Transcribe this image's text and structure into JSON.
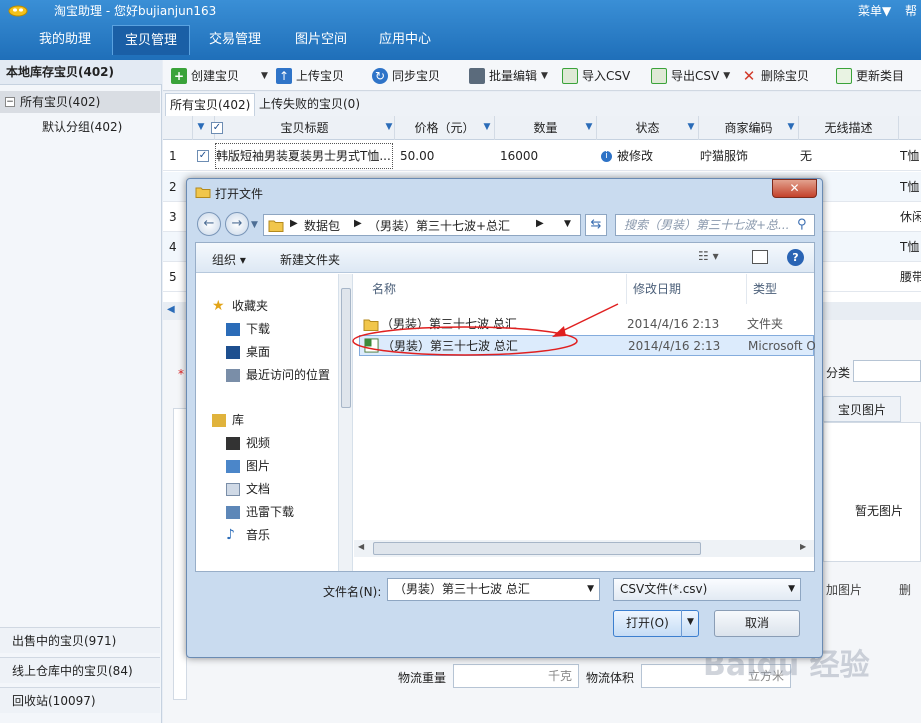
{
  "app": {
    "title": "淘宝助理 - 您好bujianjun163",
    "menu_label": "菜单▼",
    "help_label": "帮"
  },
  "nav": {
    "tabs": [
      "我的助理",
      "宝贝管理",
      "交易管理",
      "图片空间",
      "应用中心"
    ],
    "active_index": 1
  },
  "sidebar": {
    "title": "本地库存宝贝(402)",
    "tree": {
      "toggle": "−",
      "root": "所有宝贝(402)",
      "child": "默认分组(402)"
    },
    "bottom": [
      "出售中的宝贝(971)",
      "线上仓库中的宝贝(84)",
      "回收站(10097)"
    ]
  },
  "toolbar": {
    "items": [
      {
        "label": "创建宝贝",
        "icon": "plus-icon",
        "color": "#3aa33a"
      },
      {
        "label": "上传宝贝",
        "icon": "upload-icon",
        "color": "#2f74c8"
      },
      {
        "label": "同步宝贝",
        "icon": "sync-icon",
        "color": "#2f74c8"
      },
      {
        "label": "批量编辑",
        "icon": "batch-edit-icon",
        "color": "#555555"
      },
      {
        "label": "导入CSV",
        "icon": "import-csv-icon",
        "color": "#3aa33a"
      },
      {
        "label": "导出CSV",
        "icon": "export-csv-icon",
        "color": "#3aa33a"
      },
      {
        "label": "删除宝贝",
        "icon": "delete-icon",
        "color": "#d23b2b"
      },
      {
        "label": "更新类目",
        "icon": "update-category-icon",
        "color": "#3aa33a"
      }
    ]
  },
  "subtabs": [
    "所有宝贝(402)",
    "上传失败的宝贝(0)"
  ],
  "table": {
    "headers": [
      "宝贝标题",
      "价格（元）",
      "数量",
      "状态",
      "商家编码",
      "无线描述"
    ],
    "rows": [
      {
        "num": "1",
        "title": "韩版短袖男装夏装男士男式T恤...",
        "price": "50.00",
        "qty": "16000",
        "status": "被修改",
        "code": "咛猫服饰",
        "wireless": "无",
        "extra": "T恤"
      },
      {
        "num": "2",
        "extra": "T恤"
      },
      {
        "num": "3",
        "extra": "休闲"
      },
      {
        "num": "4",
        "extra": "T恤"
      },
      {
        "num": "5",
        "extra": "腰带"
      }
    ]
  },
  "background_form": {
    "category_label": "分类",
    "image_tab": "宝贝图片",
    "no_image": "暂无图片",
    "add_image": "加图片",
    "delete": "删",
    "weight_label": "物流重量",
    "weight_unit": "千克",
    "volume_label": "物流体积",
    "volume_unit": "立方米"
  },
  "dialog": {
    "title": "打开文件",
    "close": "✕",
    "address_parts": [
      "数据包",
      "（男装）第三十七波+总汇"
    ],
    "search_placeholder": "搜索（男装）第三十七波+总...",
    "organize": "组织 ▾",
    "new_folder": "新建文件夹",
    "nav": {
      "favorites": "收藏夹",
      "fav_items": [
        "下载",
        "桌面",
        "最近访问的位置"
      ],
      "libraries": "库",
      "lib_items": [
        "视频",
        "图片",
        "文档",
        "迅雷下载",
        "音乐"
      ]
    },
    "columns": [
      "名称",
      "修改日期",
      "类型"
    ],
    "files": [
      {
        "name": "（男装）第三十七波 总汇",
        "date": "2014/4/16 2:13",
        "type": "文件夹"
      },
      {
        "name": "（男装）第三十七波 总汇",
        "date": "2014/4/16 2:13",
        "type": "Microsoft O"
      }
    ],
    "filename_label": "文件名(N):",
    "filename_value": "（男装）第三十七波 总汇",
    "filetype": "CSV文件(*.csv)",
    "open_label": "打开(O)",
    "cancel_label": "取消"
  },
  "watermark": "Baidu 经验"
}
